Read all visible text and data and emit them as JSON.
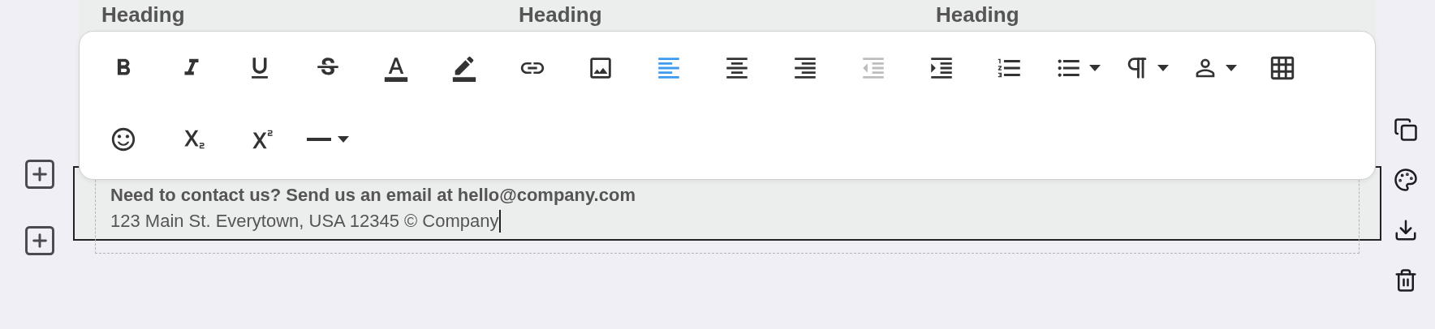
{
  "headings": [
    "Heading",
    "Heading",
    "Heading"
  ],
  "footer": {
    "contact": "Need to contact us? Send us an email at hello@company.com",
    "address": "123 Main St. Everytown, USA 12345 © Company"
  },
  "toolbar": {
    "rows": [
      [
        {
          "kind": "button",
          "selected": false,
          "disabled": false
        },
        {
          "kind": "button",
          "selected": false,
          "disabled": false
        },
        {
          "kind": "button",
          "selected": false,
          "disabled": false
        },
        {
          "kind": "button",
          "selected": false,
          "disabled": false
        },
        {
          "kind": "button",
          "selected": false,
          "disabled": false
        },
        {
          "kind": "button",
          "selected": false,
          "disabled": false
        },
        {
          "kind": "button",
          "selected": false,
          "disabled": false
        },
        {
          "kind": "button",
          "selected": false,
          "disabled": false
        },
        {
          "kind": "button",
          "selected": true,
          "disabled": false
        },
        {
          "kind": "button",
          "selected": false,
          "disabled": false
        },
        {
          "kind": "button",
          "selected": false,
          "disabled": false
        },
        {
          "kind": "button",
          "selected": false,
          "disabled": true
        },
        {
          "kind": "button",
          "selected": false,
          "disabled": false
        },
        {
          "kind": "button",
          "selected": false,
          "disabled": false
        },
        {
          "kind": "dropdown",
          "selected": false,
          "disabled": false
        },
        {
          "kind": "dropdown",
          "selected": false,
          "disabled": false
        },
        {
          "kind": "dropdown",
          "selected": false,
          "disabled": false
        },
        {
          "kind": "button",
          "selected": false,
          "disabled": false
        }
      ],
      [
        {
          "kind": "button",
          "selected": false,
          "disabled": false
        },
        {
          "kind": "button",
          "selected": false,
          "disabled": false
        },
        {
          "kind": "button",
          "selected": false,
          "disabled": false
        },
        {
          "kind": "dropdown",
          "selected": false,
          "disabled": false
        }
      ]
    ]
  }
}
